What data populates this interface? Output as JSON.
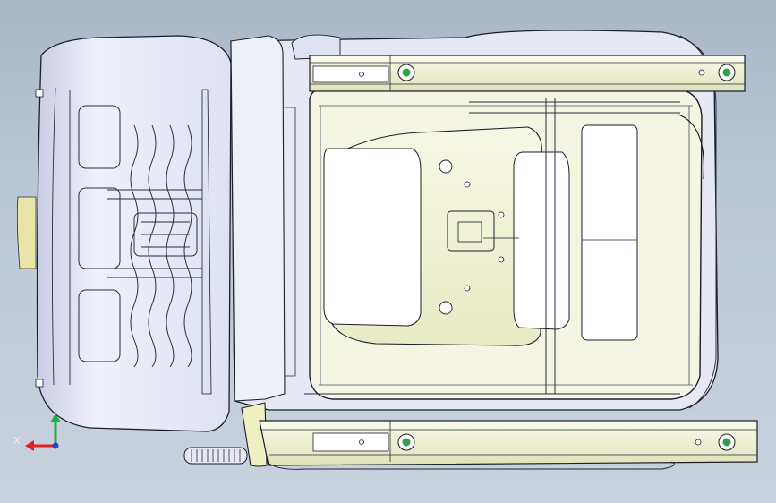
{
  "viewport": {
    "background_top": "#a9b7c8",
    "background_bottom": "#c8d2dd"
  },
  "model": {
    "body_color": "#e9ebf6",
    "shade_color": "#cdd0e6",
    "pan_color": "#f4f5d8",
    "rail_color": "#f2f3d6",
    "edge_color": "#1c1e2c",
    "bolt_color": "#2fa14a"
  },
  "axis_triad": {
    "x_label": "X",
    "x_color": "#e02020",
    "y_color": "#20b040",
    "z_color": "#2040e0"
  }
}
